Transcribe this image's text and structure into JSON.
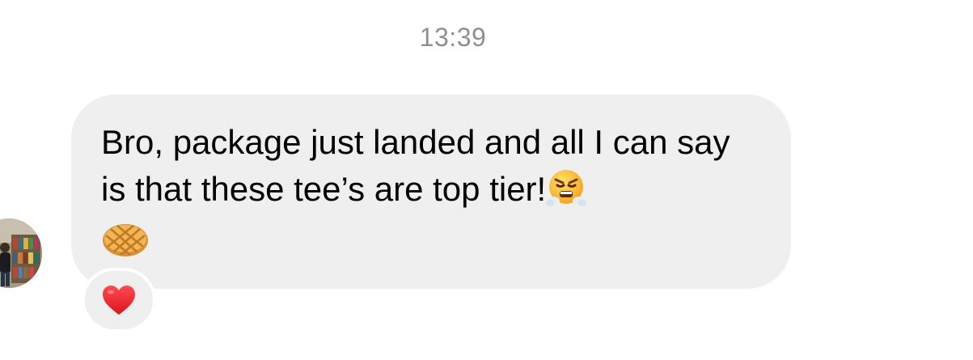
{
  "conversation": {
    "timestamp": "13:39",
    "message": {
      "text": "Bro, package just landed and all I can say is that these tee’s are top tier!",
      "emojis": [
        "face-with-steam-from-nose",
        "waffle"
      ],
      "reaction": "red-heart"
    },
    "sender": {
      "avatar_icon": "profile-photo"
    }
  },
  "colors": {
    "bubble": "#efefef",
    "timestamp": "#8e8e93",
    "text": "#000000",
    "heart": "#e8202a"
  }
}
